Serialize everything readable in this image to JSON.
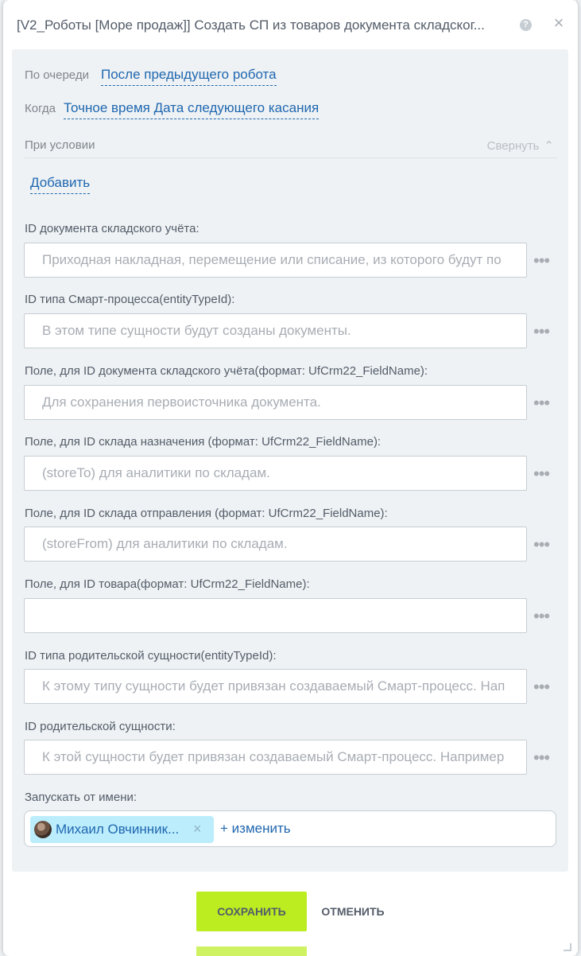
{
  "dialog": {
    "title": "[V2_Роботы [Море продаж]] Создать СП из товаров документа складског...",
    "help_glyph": "?",
    "close_glyph": "×"
  },
  "settings": {
    "queue_label": "По очереди",
    "queue_value": "После предыдущего робота",
    "when_label": "Когда",
    "when_value": "Точное время Дата следующего касания",
    "condition_label": "При условии",
    "collapse_label": "Свернуть",
    "collapse_chevron": "⌃",
    "add_label": "Добавить"
  },
  "fields": [
    {
      "label": "ID документа складского учёта:",
      "placeholder": "Приходная накладная, перемещение или списание, из которого будут по"
    },
    {
      "label": "ID типа Смарт-процесса(entityTypeId):",
      "placeholder": "В этом типе сущности будут созданы документы."
    },
    {
      "label": "Поле, для ID документа складского учёта(формат: UfCrm22_FieldName):",
      "placeholder": "Для сохранения первоисточника документа."
    },
    {
      "label": "Поле, для ID склада назначения (формат: UfCrm22_FieldName):",
      "placeholder": "(storeTo) для аналитики по складам."
    },
    {
      "label": "Поле, для ID склада отправления (формат: UfCrm22_FieldName):",
      "placeholder": "(storeFrom) для аналитики по складам."
    },
    {
      "label": "Поле, для ID товара(формат: UfCrm22_FieldName):",
      "placeholder": ""
    },
    {
      "label": "ID типа родительской сущности(entityTypeId):",
      "placeholder": "К этому типу сущности будет привязан создаваемый Смарт-процесс. Нап"
    },
    {
      "label": "ID родительской сущности:",
      "placeholder": "К этой сущности будет привязан создаваемый Смарт-процесс. Например"
    }
  ],
  "dots_glyph": "•••",
  "run_as": {
    "label": "Запускать от имени:",
    "user_name": "Михаил Овчинник...",
    "remove_glyph": "×",
    "change_label": "+ изменить"
  },
  "footer": {
    "save_label": "СОХРАНИТЬ",
    "cancel_label": "ОТМЕНИТЬ"
  },
  "colors": {
    "accent_link": "#2067b0",
    "save_button": "#bbed21",
    "panel_bg": "#eef2f4",
    "chip_bg": "#bcedfc"
  }
}
